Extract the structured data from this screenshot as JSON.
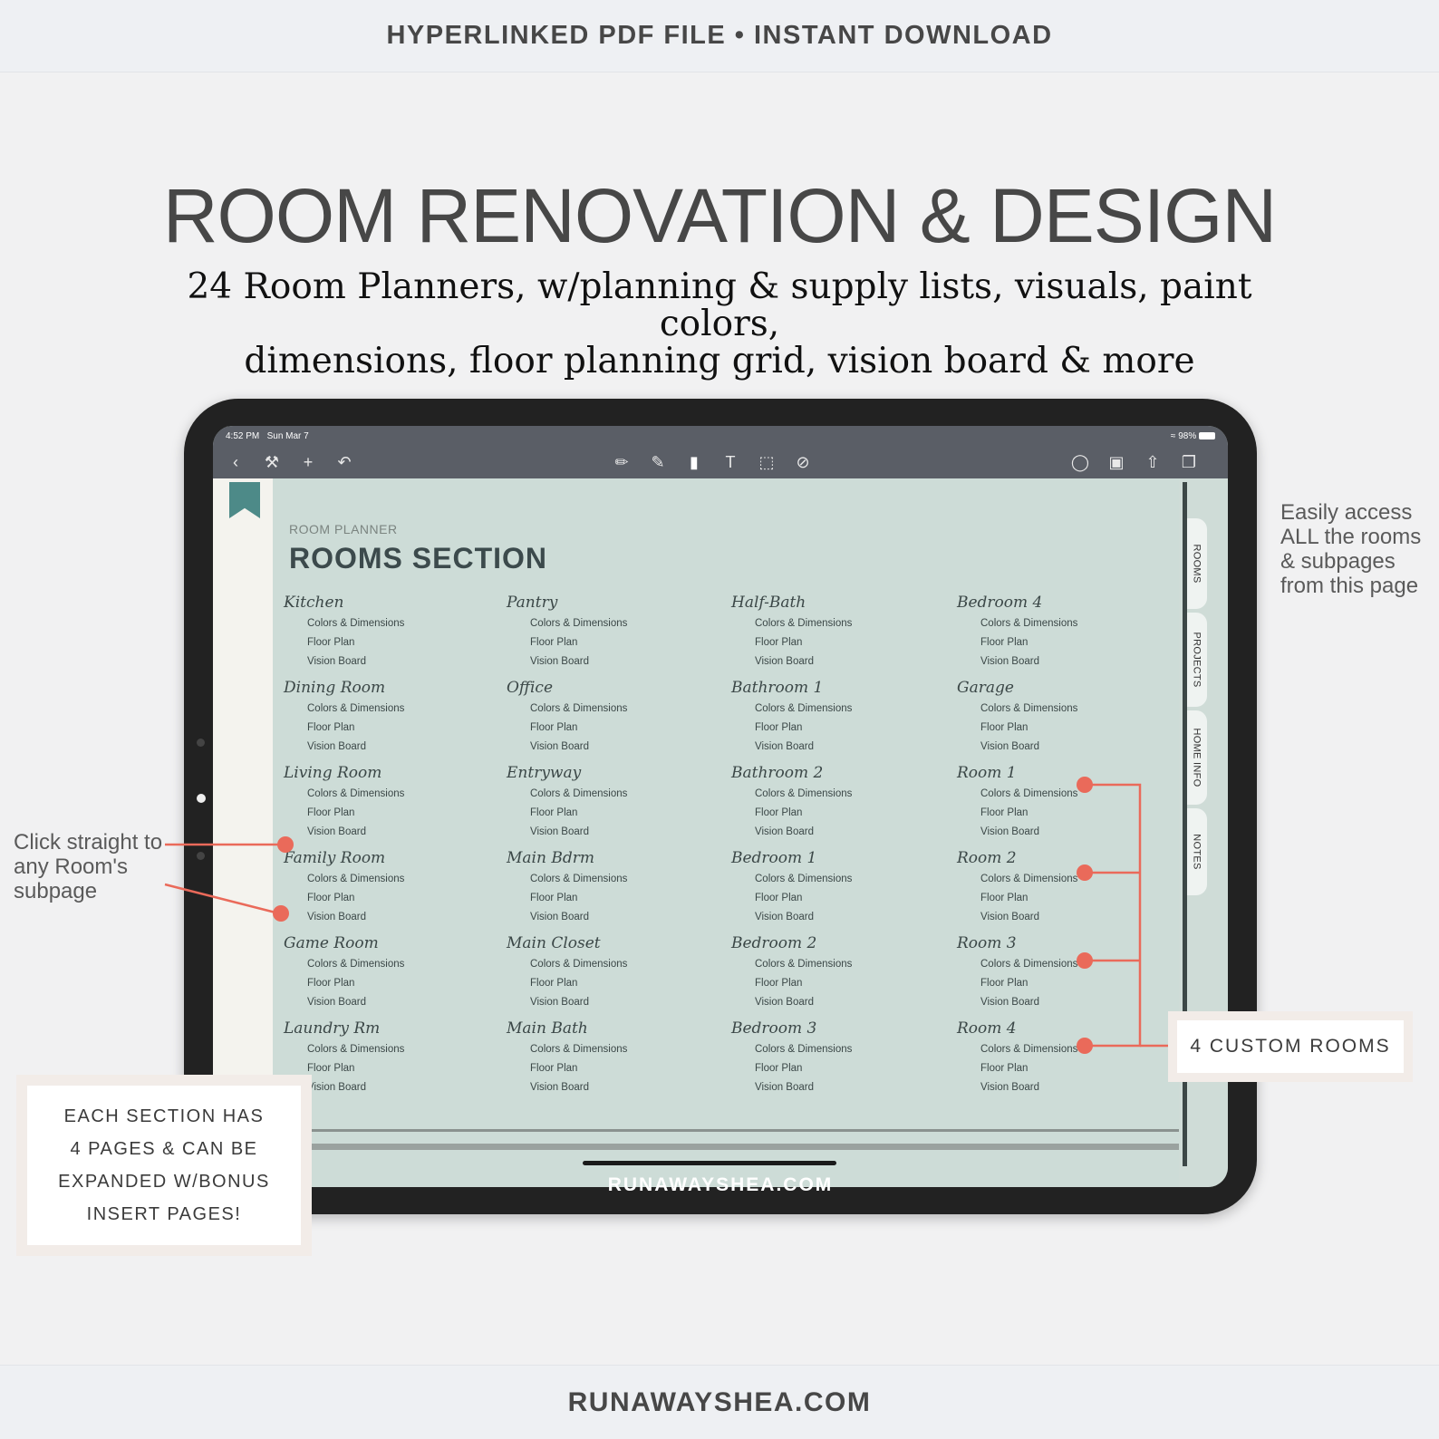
{
  "top_banner": "HYPERLINKED PDF FILE • INSTANT DOWNLOAD",
  "title": "ROOM RENOVATION & DESIGN",
  "subtitle_line1": "24 Room Planners, w/planning & supply lists, visuals, paint colors,",
  "subtitle_line2": "dimensions, floor planning grid, vision board & more",
  "status": {
    "time": "4:52 PM",
    "date": "Sun Mar 7",
    "battery": "98%"
  },
  "planner": {
    "label": "ROOM PLANNER",
    "title": "ROOMS SECTION",
    "sub_items": [
      "Colors & Dimensions",
      "Floor Plan",
      "Vision Board"
    ],
    "columns": [
      [
        "Kitchen",
        "Dining Room",
        "Living Room",
        "Family Room",
        "Game Room",
        "Laundry Rm"
      ],
      [
        "Pantry",
        "Office",
        "Entryway",
        "Main Bdrm",
        "Main Closet",
        "Main Bath"
      ],
      [
        "Half-Bath",
        "Bathroom 1",
        "Bathroom 2",
        "Bedroom 1",
        "Bedroom 2",
        "Bedroom 3"
      ],
      [
        "Bedroom 4",
        "Garage",
        "Room 1",
        "Room 2",
        "Room 3",
        "Room 4"
      ]
    ]
  },
  "tabs": [
    "ROOMS",
    "PROJECTS",
    "HOME INFO",
    "NOTES"
  ],
  "tablet_caption": "RUNAWAYSHEA.COM",
  "note_right": "Easily access ALL the rooms & subpages from this page",
  "note_left": "Click straight to any Room's subpage",
  "callout_lines": [
    "EACH SECTION HAS",
    "4 PAGES & CAN BE",
    "EXPANDED W/BONUS",
    "INSERT PAGES!"
  ],
  "custom_rooms": "4 CUSTOM ROOMS",
  "bottom_banner": "RUNAWAYSHEA.COM",
  "colors": {
    "accent": "#ea6a5a",
    "page": "#cddcd7",
    "bookmark": "#4d8a88"
  }
}
